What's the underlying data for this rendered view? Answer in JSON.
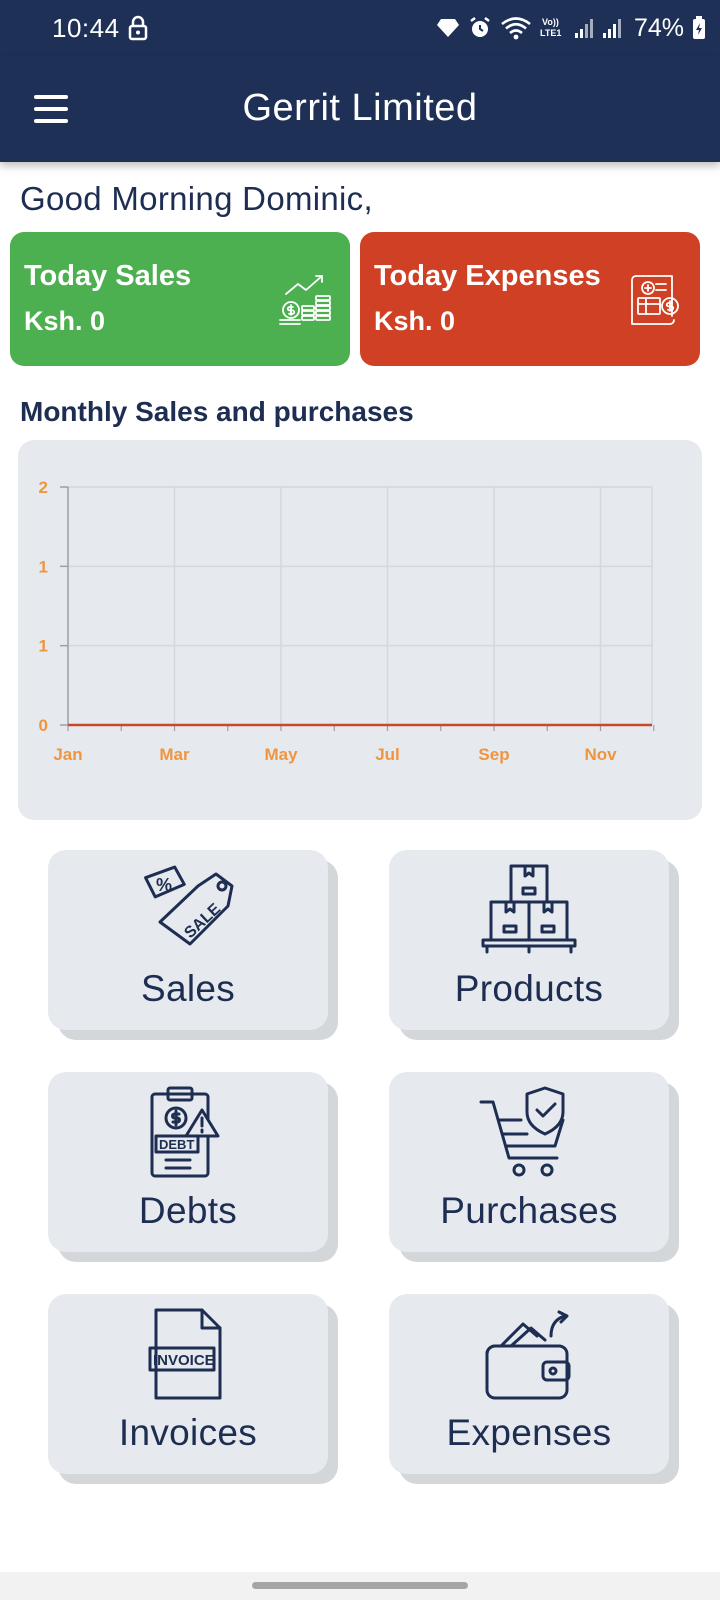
{
  "status_bar": {
    "time": "10:44",
    "battery": "74%",
    "icons": [
      "lock-icon",
      "gem-icon",
      "alarm-icon",
      "wifi-icon",
      "volte-icon",
      "signal-icon",
      "signal-icon",
      "battery-icon"
    ],
    "volte_label": "Vo)) LTE1"
  },
  "app_bar": {
    "title": "Gerrit Limited",
    "menu_icon": "hamburger-menu-icon"
  },
  "greeting": "Good Morning Dominic,",
  "stats": {
    "sales": {
      "title": "Today Sales",
      "value": "Ksh. 0",
      "icon": "money-growth-icon",
      "color": "#4caf50"
    },
    "expenses": {
      "title": "Today Expenses",
      "value": "Ksh. 0",
      "icon": "medical-bill-icon",
      "color": "#cf4025"
    }
  },
  "chart_section": {
    "title": "Monthly Sales and purchases"
  },
  "chart_data": {
    "type": "line",
    "title": "Monthly Sales and purchases",
    "x_tick_labels": [
      "Jan",
      "Mar",
      "May",
      "Jul",
      "Sep",
      "Nov"
    ],
    "y_tick_labels": [
      "0",
      "1",
      "1",
      "2"
    ],
    "ylim": [
      0,
      2
    ],
    "series": [
      {
        "values": [
          0,
          0,
          0,
          0,
          0,
          0,
          0,
          0,
          0,
          0,
          0,
          0
        ],
        "color": "#c8492a"
      }
    ],
    "grid": true,
    "tick_color": "#f0953f"
  },
  "tiles": [
    {
      "label": "Sales",
      "icon": "sale-tag-icon"
    },
    {
      "label": "Products",
      "icon": "boxes-pallet-icon"
    },
    {
      "label": "Debts",
      "icon": "debt-clipboard-icon"
    },
    {
      "label": "Purchases",
      "icon": "cart-shield-icon"
    },
    {
      "label": "Invoices",
      "icon": "invoice-document-icon"
    },
    {
      "label": "Expenses",
      "icon": "wallet-icon"
    }
  ],
  "colors": {
    "primary": "#1f3057",
    "text": "#1e2d52",
    "card_bg": "#e6eaee",
    "sales_green": "#4caf50",
    "expense_red": "#cf4025"
  }
}
